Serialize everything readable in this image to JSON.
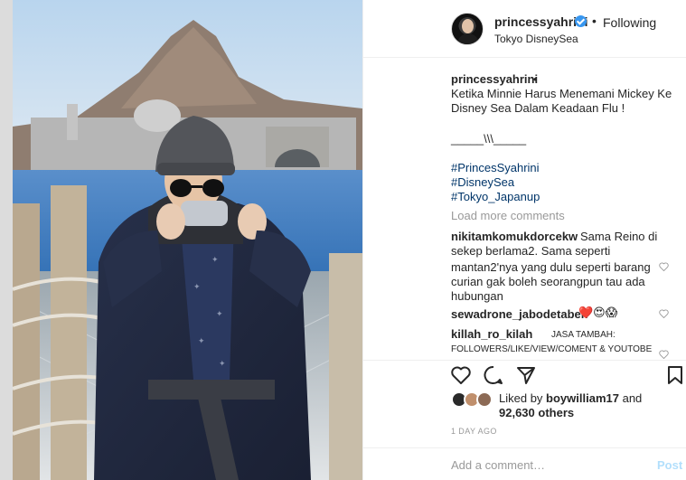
{
  "header": {
    "username": "princessyahrini",
    "separator": "•",
    "follow_status": "Following",
    "location": "Tokyo DisneySea"
  },
  "caption": {
    "username": "princessyahrini",
    "separator": "•",
    "lines": [
      "Ketika Minnie Harus Menemani Mickey Ke",
      "Disney Sea Dalam Keadaan Flu !"
    ],
    "divider": "_____\\\\\\_____",
    "hashtags": [
      "#PrincesSyahrini",
      "#DisneySea",
      "#Tokyo_Japanup"
    ]
  },
  "load_more": "Load more comments",
  "comments": [
    {
      "username": "nikitamkomukdorcekw",
      "text_first": "Sama Reino di",
      "lines": [
        "sekep berlama2. Sama seperti",
        "mantan2'nya yang dulu seperti barang",
        "curian gak boleh seorangpun tau ada",
        "hubungan"
      ]
    },
    {
      "username": "sewadrone_jabodetabek",
      "text_first": "❤️😍😱",
      "lines": []
    },
    {
      "username": "killah_ro_kilah",
      "text_first": "JASA TAMBAH:",
      "lines": [
        "FOLLOWERS/LIKE/VIEW/COMENT & YOUTOBE"
      ]
    }
  ],
  "likes": {
    "prefix": "Liked by",
    "user": "boywilliam17",
    "connector": "and",
    "others": "92,630 others"
  },
  "timestamp": "1 DAY AGO",
  "add_comment_placeholder": "Add a comment…",
  "post_label": "Post",
  "colors": {
    "link": "#003569",
    "muted": "#999999",
    "verified": "#3897f0"
  }
}
